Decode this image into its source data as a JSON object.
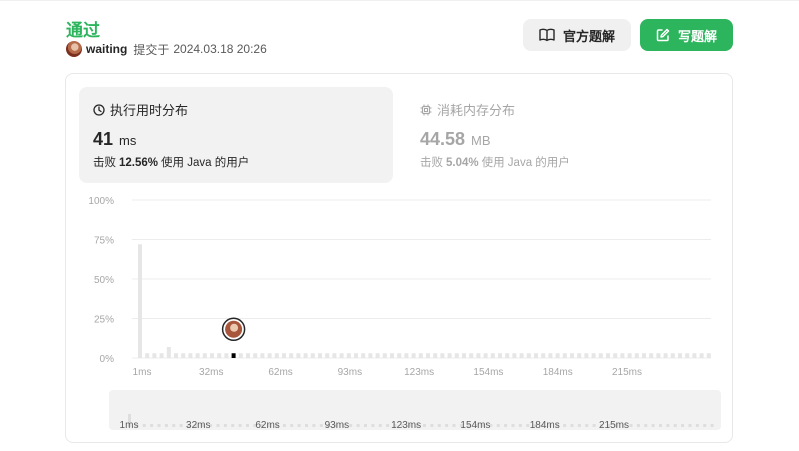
{
  "header": {
    "status": "通过",
    "username": "waiting",
    "submitted_prefix": "提交于",
    "submitted_time": "2024.03.18 20:26",
    "official_solution_label": "官方题解",
    "write_solution_label": "写题解"
  },
  "runtime": {
    "title": "执行用时分布",
    "value": "41",
    "unit": "ms",
    "beat_prefix": "击败",
    "beat_percent": "12.56%",
    "beat_suffix": "使用 Java 的用户"
  },
  "memory": {
    "title": "消耗内存分布",
    "value": "44.58",
    "unit": "MB",
    "beat_prefix": "击败",
    "beat_percent": "5.04%",
    "beat_suffix": "使用 Java 的用户"
  },
  "colors": {
    "accent": "#2db55d",
    "bar": "#e6e6e6",
    "marker": "#000000"
  },
  "chart_data": {
    "type": "bar",
    "y_ticks": [
      "100%",
      "75%",
      "50%",
      "25%",
      "0%"
    ],
    "ylim": [
      0,
      100
    ],
    "x_ticks": [
      "1ms",
      "32ms",
      "62ms",
      "93ms",
      "123ms",
      "154ms",
      "184ms",
      "215ms"
    ],
    "values": [
      72,
      3,
      3,
      3,
      7,
      3,
      3,
      3,
      3,
      3,
      3,
      3,
      3,
      3,
      3,
      3,
      3,
      3,
      3,
      3,
      3,
      3,
      3,
      3,
      3,
      3,
      3,
      3,
      3,
      3,
      3,
      3,
      3,
      3,
      3,
      3,
      3,
      3,
      3,
      3,
      3,
      3,
      3,
      3,
      3,
      3,
      3,
      3,
      3,
      3,
      3,
      3,
      3,
      3,
      3,
      3,
      3,
      3,
      3,
      3,
      3,
      3,
      3,
      3,
      3,
      3,
      3,
      3,
      3,
      3,
      3,
      3,
      3,
      3,
      3,
      3,
      3,
      3,
      3,
      3
    ],
    "highlight_index": 13,
    "grid": true
  },
  "range_slider": {
    "x_ticks": [
      "1ms",
      "32ms",
      "62ms",
      "93ms",
      "123ms",
      "154ms",
      "184ms",
      "215ms"
    ]
  }
}
